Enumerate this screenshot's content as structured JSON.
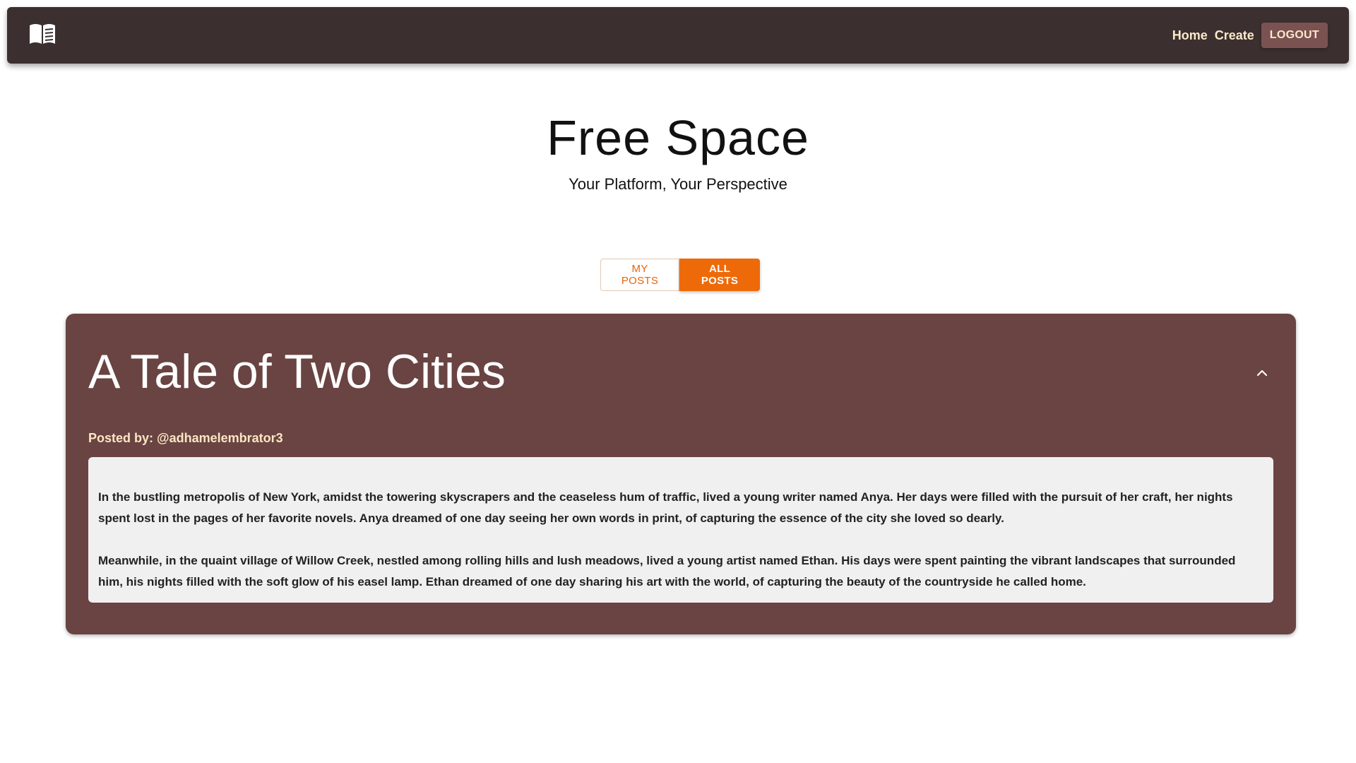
{
  "navbar": {
    "logo_icon": "open-book-icon",
    "links": [
      "Home",
      "Create"
    ],
    "logout_label": "LOGOUT",
    "background": "#3b2f2f",
    "link_color": "#fbe9c9"
  },
  "hero": {
    "title": "Free Space",
    "subtitle": "Your Platform, Your Perspective"
  },
  "toggle": {
    "my_posts_label": "MY POSTS",
    "all_posts_label": "ALL POSTS",
    "active": "ALL POSTS",
    "accent": "#ee6a09"
  },
  "post": {
    "title": "A Tale of Two Cities",
    "posted_by": "Posted by: @adhamelembrator3",
    "collapse_icon": "chevron-up-icon",
    "card_color": "#694442",
    "paragraphs": [
      "In the bustling metropolis of New York, amidst the towering skyscrapers and the ceaseless hum of traffic, lived a young writer named Anya. Her days were filled with the pursuit of her craft, her nights spent lost in the pages of her favorite novels. Anya dreamed of one day seeing her own words in print, of capturing the essence of the city she loved so dearly.",
      "Meanwhile, in the quaint village of Willow Creek, nestled among rolling hills and lush meadows, lived a young artist named Ethan. His days were spent painting the vibrant landscapes that surrounded him, his nights filled with the soft glow of his easel lamp. Ethan dreamed of one day sharing his art with the world, of capturing the beauty of the countryside he called home."
    ]
  }
}
